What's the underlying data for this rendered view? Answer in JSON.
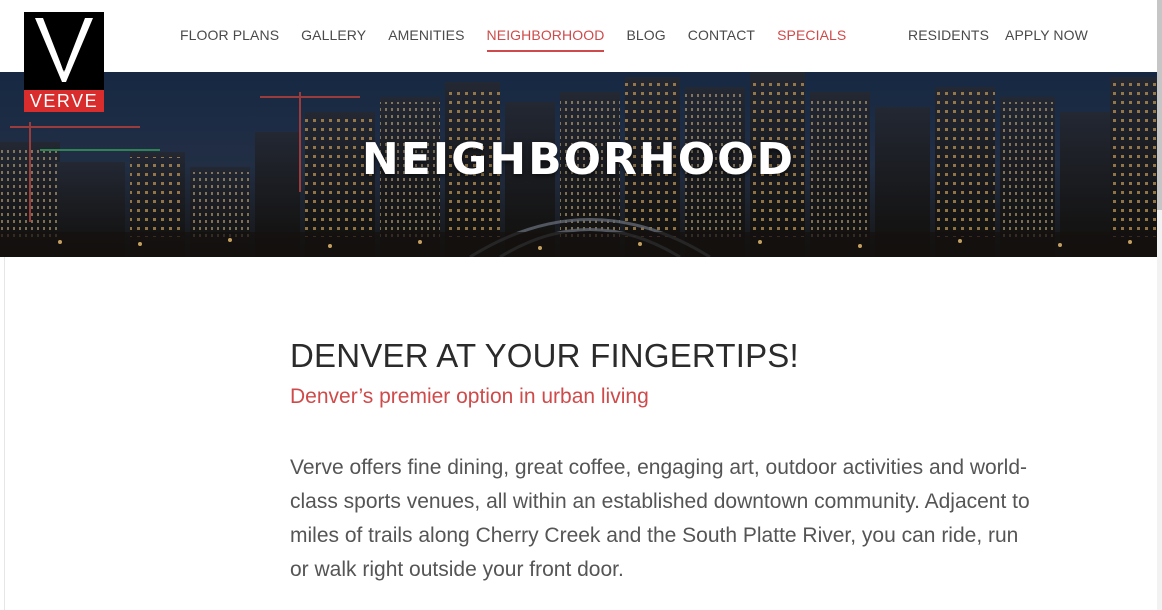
{
  "brand": {
    "name": "VERVE",
    "colors": {
      "accent": "#cf4a4a",
      "logo_red": "#d92d2d",
      "logo_black": "#000000"
    }
  },
  "nav": {
    "main": [
      {
        "label": "FLOOR PLANS"
      },
      {
        "label": "GALLERY"
      },
      {
        "label": "AMENITIES"
      },
      {
        "label": "NEIGHBORHOOD",
        "active": true
      },
      {
        "label": "BLOG"
      },
      {
        "label": "CONTACT"
      },
      {
        "label": "SPECIALS",
        "accent": true
      }
    ],
    "right": [
      {
        "label": "RESIDENTS"
      },
      {
        "label": "APPLY NOW"
      }
    ]
  },
  "hero": {
    "title": "NEIGHBORHOOD",
    "image": "denver-skyline-night"
  },
  "content": {
    "heading": "DENVER AT YOUR FINGERTIPS!",
    "subheading": "Denver’s premier option in urban living",
    "body": "Verve offers fine dining, great coffee, engaging art, outdoor activities and world-class sports venues, all within an established downtown community. Adjacent to miles of trails along Cherry Creek and the South Platte River, you can ride, run or walk right outside your front door."
  }
}
